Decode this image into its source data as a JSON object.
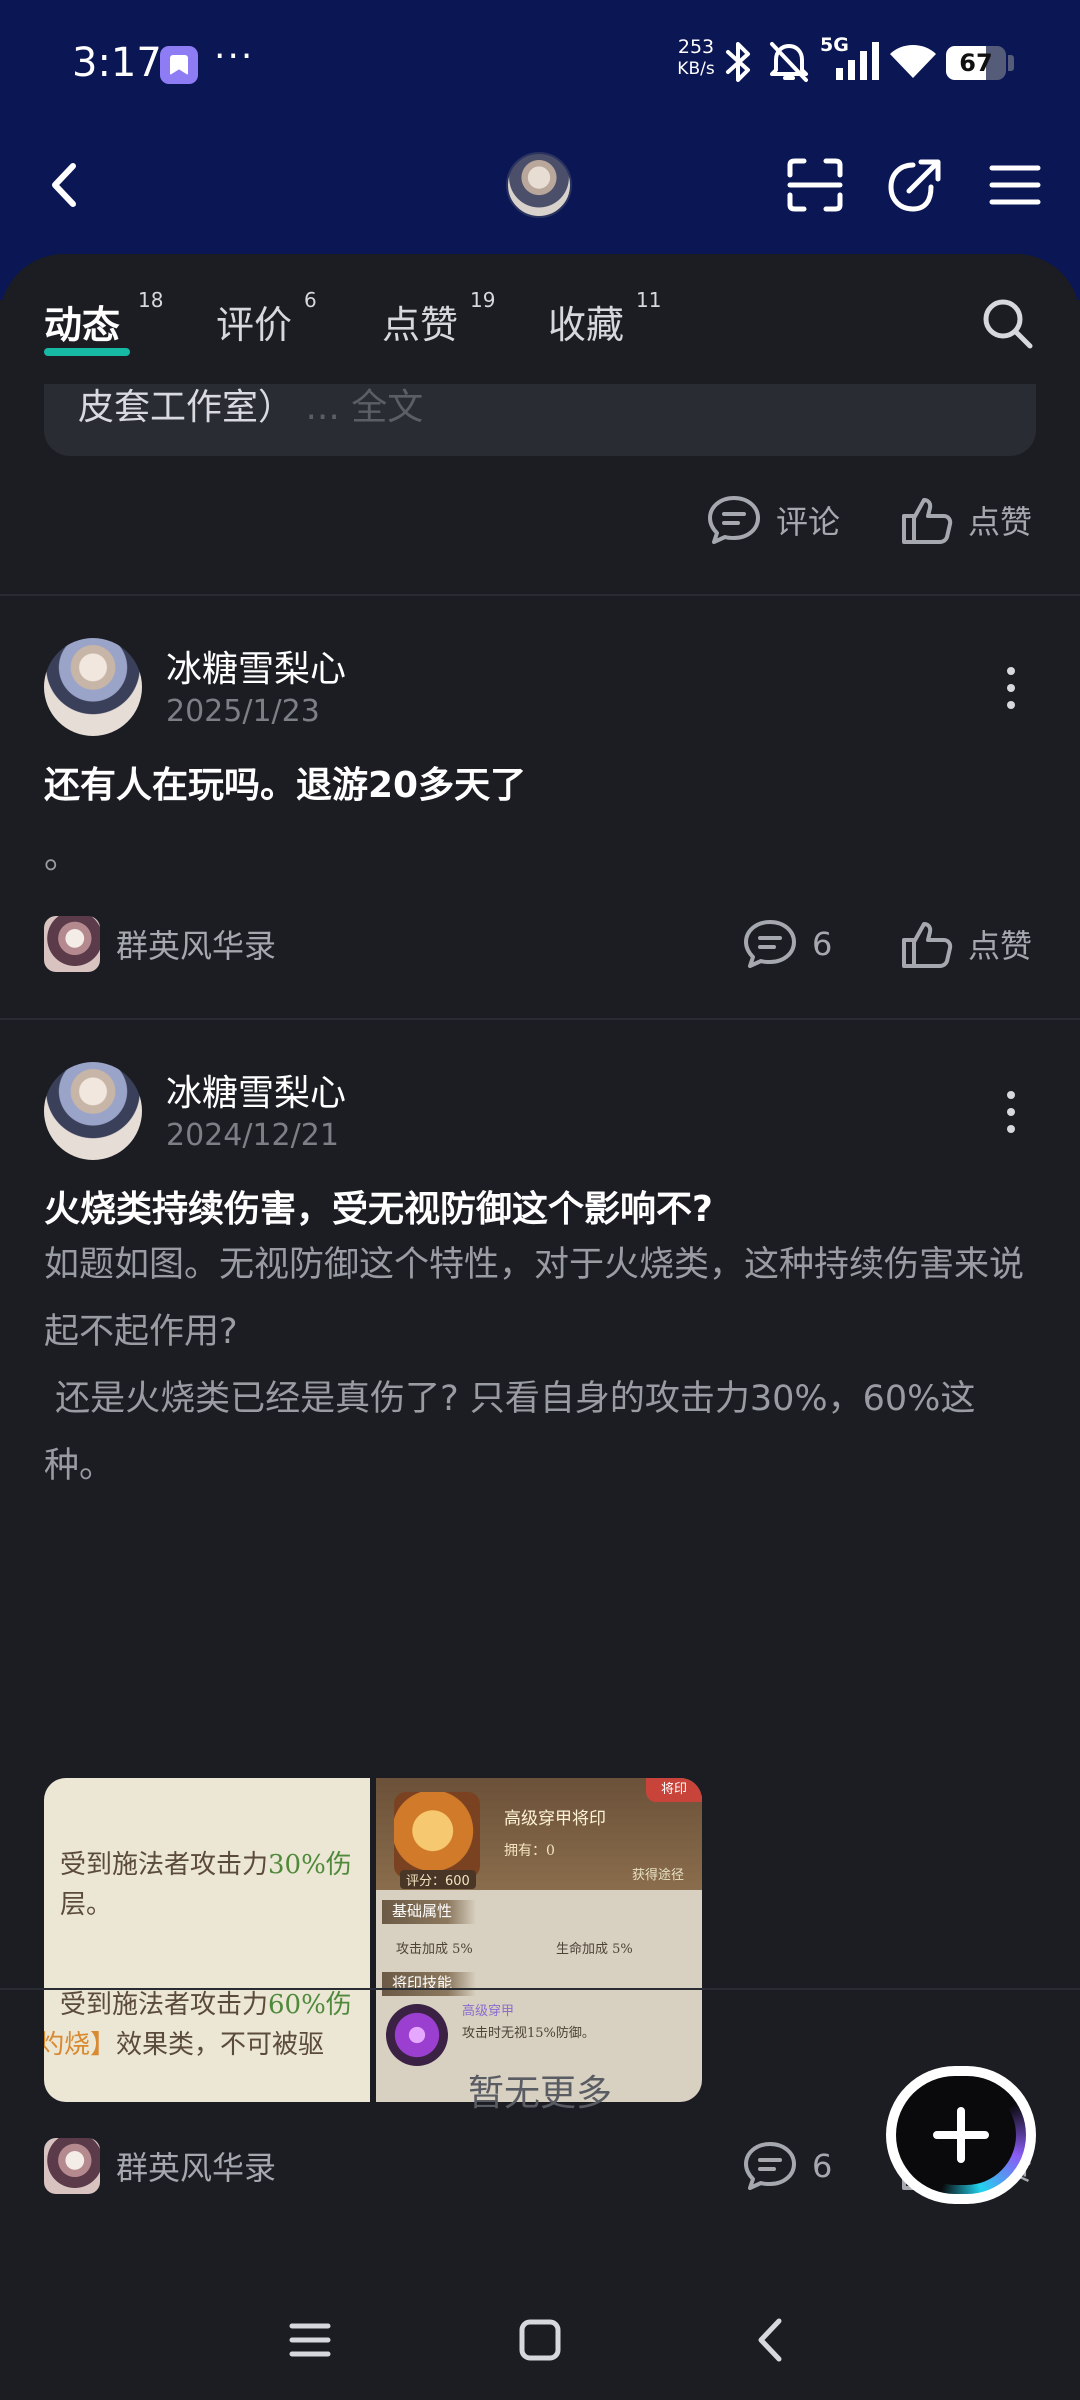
{
  "status_bar": {
    "time": "3:17",
    "more": "···",
    "net_speed_value": "253",
    "net_speed_unit": "KB/s",
    "network": "5G",
    "battery": "67",
    "battery_level": 0.67,
    "icons": [
      "app-notification-icon",
      "bluetooth-icon",
      "mute-icon",
      "signal-icon",
      "wifi-icon",
      "battery-icon"
    ]
  },
  "header": {
    "icons": [
      "back-icon",
      "profile-avatar",
      "scan-icon",
      "share-icon",
      "menu-icon"
    ]
  },
  "tabs": [
    {
      "label": "动态",
      "count": "18",
      "active": true
    },
    {
      "label": "评价",
      "count": "6",
      "active": false
    },
    {
      "label": "点赞",
      "count": "19",
      "active": false
    },
    {
      "label": "收藏",
      "count": "11",
      "active": false
    }
  ],
  "previous_post": {
    "quote_text": "皮套工作室）",
    "quote_more": "... 全文",
    "comment_label": "评论",
    "like_label": "点赞"
  },
  "posts": [
    {
      "username": "冰糖雪梨心",
      "date": "2025/1/23",
      "title": "还有人在玩吗。退游20多天了",
      "body": "。",
      "game": "群英风华录",
      "comments": "6",
      "like_label": "点赞"
    },
    {
      "username": "冰糖雪梨心",
      "date": "2024/12/21",
      "title": "火烧类持续伤害，受无视防御这个影响不?",
      "body": "如题如图。无视防御这个特性，对于火烧类，这种持续伤害来说起不起作用?\n 还是火烧类已经是真伤了? 只看自身的攻击力30%，60%这种。",
      "game": "群英风华录",
      "comments": "6",
      "like_label": "点赞",
      "image1": {
        "line1a": "受到施法者攻击力",
        "line1b": "30%伤",
        "line2": "层。",
        "line3a": "受到施法者攻击力",
        "line3b": "60%伤",
        "line4a": "灼烧】",
        "line4b": "效果类，不可被驱"
      },
      "image2": {
        "corner": "将印",
        "name": "高级穿甲将印",
        "own": "拥有：0",
        "score": "评分：600",
        "link": "获得途径",
        "section1": "基础属性",
        "stat1": "攻击加成  5%",
        "stat2": "生命加成  5%",
        "section2": "将印技能",
        "skill_name": "高级穿甲",
        "skill_desc": "攻击时无视15%防御。"
      }
    }
  ],
  "footer": {
    "no_more": "暂无更多"
  },
  "colors": {
    "header_bg": "#0b1654",
    "page_bg": "#1b1d23",
    "accent": "#17b9a5",
    "card_bg": "#2a2c33"
  }
}
